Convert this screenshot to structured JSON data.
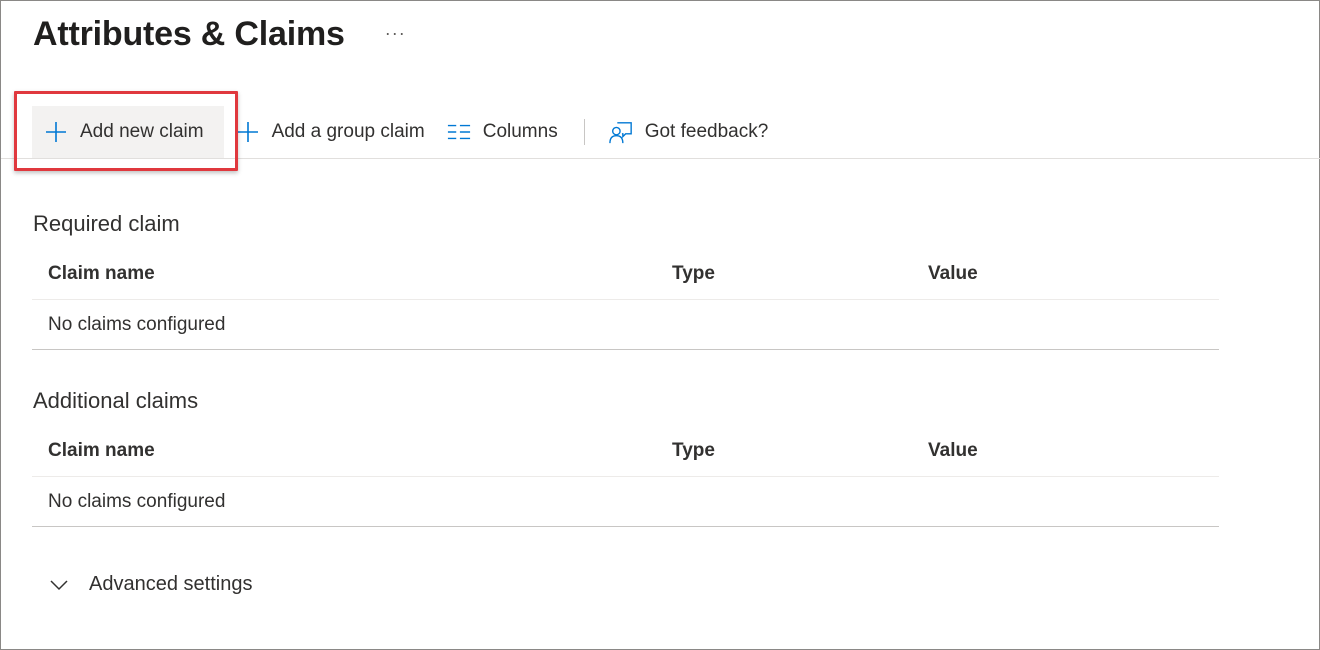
{
  "header": {
    "title": "Attributes & Claims",
    "more_label": "···"
  },
  "toolbar": {
    "add_new_claim": "Add new claim",
    "add_group_claim": "Add a group claim",
    "columns": "Columns",
    "feedback": "Got feedback?"
  },
  "colors": {
    "accent": "#0078d4",
    "highlight_border": "#e0383e"
  },
  "required": {
    "title": "Required claim",
    "columns": [
      "Claim name",
      "Type",
      "Value"
    ],
    "empty_text": "No claims configured"
  },
  "additional": {
    "title": "Additional claims",
    "columns": [
      "Claim name",
      "Type",
      "Value"
    ],
    "empty_text": "No claims configured"
  },
  "advanced": {
    "label": "Advanced settings"
  }
}
